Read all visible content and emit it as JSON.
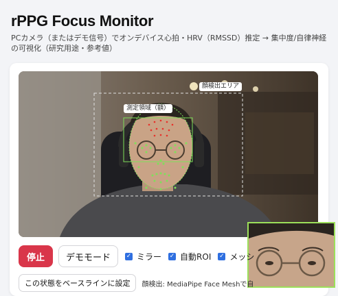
{
  "header": {
    "title": "rPPG Focus Monitor",
    "subtitle": "PCカメラ（またはデモ信号）でオンデバイス心拍・HRV（RMSSD）推定 → 集中度/自律神経の可視化（研究用途・参考値）"
  },
  "video": {
    "face_box_label": "顔検出エリア",
    "roi_label": "測定領域（額）",
    "colors": {
      "landmark": "#7fe05a",
      "roi": "#e8302a"
    }
  },
  "controls": {
    "stop_label": "停止",
    "demo_label": "デモモード",
    "mirror_label": "ミラー",
    "auto_roi_label": "自動ROI",
    "mesh_label": "メッシ",
    "baseline_label": "この状態をベースラインに設定",
    "status_text": "顔検出: MediaPipe Face Meshで自",
    "accent": "#d9364a",
    "check_color": "#2f6fe0"
  }
}
